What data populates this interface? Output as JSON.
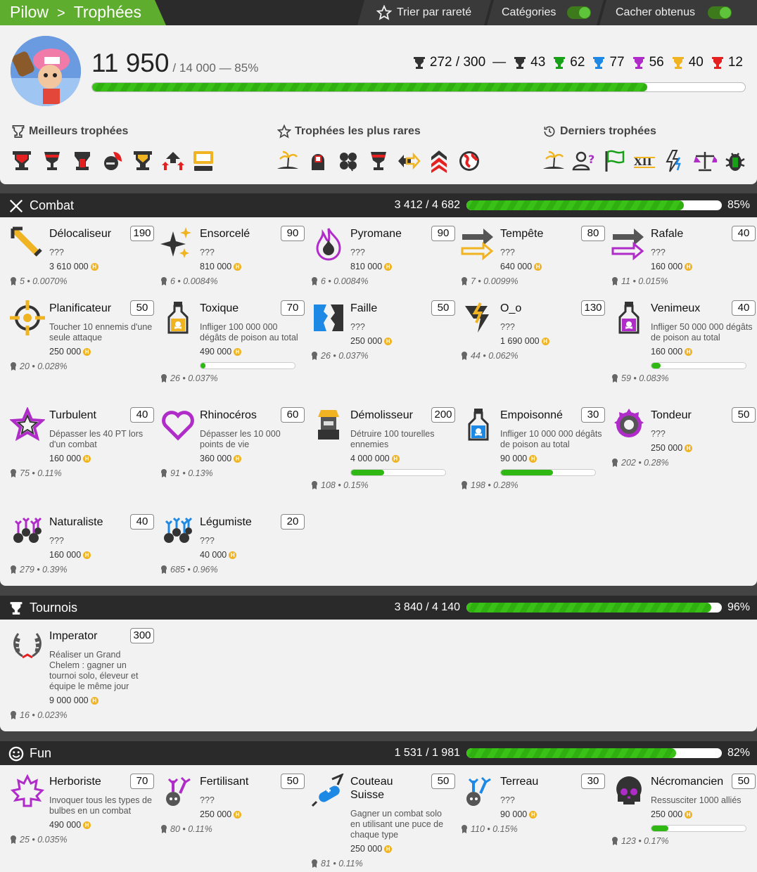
{
  "breadcrumb": {
    "user": "Pilow",
    "page": "Trophées"
  },
  "toolbar": {
    "sort": "Trier par rareté",
    "categories": "Catégories",
    "hide": "Cacher obtenus",
    "categories_on": true,
    "hide_on": true
  },
  "profile": {
    "score": "11 950",
    "max": "/ 14 000 — 85%",
    "progress": 0.85,
    "counts": {
      "total": "272 / 300",
      "dash": "—",
      "grey": "43",
      "green": "62",
      "blue": "77",
      "purple": "56",
      "gold": "40",
      "red": "12"
    },
    "best_label": "Meilleurs trophées",
    "rare_label": "Trophées les plus rares",
    "last_label": "Derniers trophées"
  },
  "colors": {
    "accent": "#5fad2f",
    "grey": "#333333",
    "green": "#18a018",
    "blue": "#1e88e5",
    "purple": "#b02cc9",
    "gold": "#f0b423",
    "red": "#e52020"
  },
  "categories": [
    {
      "name": "Combat",
      "score": "3 412 / 4 682",
      "pct": "85%",
      "progress": 0.85,
      "trophies": [
        {
          "name": "Délocaliseur",
          "points": "190",
          "desc": "???",
          "reward": "3 610 000",
          "rarity": "5 • 0.0070%",
          "icon": "sword-diagonal-icon"
        },
        {
          "name": "Ensorcelé",
          "points": "90",
          "desc": "???",
          "reward": "810 000",
          "rarity": "6 • 0.0084%",
          "icon": "sparkles-icon"
        },
        {
          "name": "Pyromane",
          "points": "90",
          "desc": "???",
          "reward": "810 000",
          "rarity": "6 • 0.0084%",
          "icon": "flames-icon"
        },
        {
          "name": "Tempête",
          "points": "80",
          "desc": "???",
          "reward": "640 000",
          "rarity": "7 • 0.0099%",
          "icon": "double-arrow-icon"
        },
        {
          "name": "Rafale",
          "points": "40",
          "desc": "???",
          "reward": "160 000",
          "rarity": "11 • 0.015%",
          "icon": "double-arrow-icon"
        },
        {
          "name": "Planificateur",
          "points": "50",
          "desc": "Toucher 10 ennemis d'une seule attaque",
          "reward": "250 000",
          "rarity": "20 • 0.028%",
          "icon": "crosshair-icon"
        },
        {
          "name": "Toxique",
          "points": "70",
          "desc": "Infliger 100 000 000 dégâts de poison au total",
          "reward": "490 000",
          "progress": 0.05,
          "rarity": "26 • 0.037%",
          "icon": "poison-bottle-icon"
        },
        {
          "name": "Faille",
          "points": "50",
          "desc": "???",
          "reward": "250 000",
          "rarity": "26 • 0.037%",
          "icon": "broken-wall-icon"
        },
        {
          "name": "O_o",
          "points": "130",
          "desc": "???",
          "reward": "1 690 000",
          "rarity": "44 • 0.062%",
          "icon": "lightning-tornado-icon"
        },
        {
          "name": "Venimeux",
          "points": "40",
          "desc": "Infliger 50 000 000 dégâts de poison au total",
          "reward": "160 000",
          "progress": 0.1,
          "rarity": "59 • 0.083%",
          "icon": "poison-bottle-icon"
        },
        {
          "name": "Turbulent",
          "points": "40",
          "desc": "Dépasser les 40 PT lors d'un combat",
          "reward": "160 000",
          "rarity": "75 • 0.11%",
          "icon": "star-outline-icon"
        },
        {
          "name": "Rhinocéros",
          "points": "60",
          "desc": "Dépasser les 10 000 points de vie",
          "reward": "360 000",
          "rarity": "91 • 0.13%",
          "icon": "heart-outline-icon"
        },
        {
          "name": "Démolisseur",
          "points": "200",
          "desc": "Détruire 100 tourelles ennemies",
          "reward": "4 000 000",
          "progress": 0.35,
          "rarity": "108 • 0.15%",
          "icon": "turret-icon"
        },
        {
          "name": "Empoisonné",
          "points": "30",
          "desc": "Infliger 10 000 000 dégâts de poison au total",
          "reward": "90 000",
          "progress": 0.55,
          "rarity": "198 • 0.28%",
          "icon": "poison-bottle-icon"
        },
        {
          "name": "Tondeur",
          "points": "50",
          "desc": "???",
          "reward": "250 000",
          "rarity": "202 • 0.28%",
          "icon": "saw-blade-icon"
        },
        {
          "name": "Naturaliste",
          "points": "40",
          "desc": "???",
          "reward": "160 000",
          "rarity": "279 • 0.39%",
          "icon": "bulbs-icon"
        },
        {
          "name": "Légumiste",
          "points": "20",
          "desc": "???",
          "reward": "40 000",
          "rarity": "685 • 0.96%",
          "icon": "bulbs-icon"
        }
      ]
    },
    {
      "name": "Tournois",
      "score": "3 840 / 4 140",
      "pct": "96%",
      "progress": 0.96,
      "trophies": [
        {
          "name": "Imperator",
          "points": "300",
          "desc": "Réaliser un Grand Chelem : gagner un tournoi solo, éleveur et équipe le même jour",
          "reward": "9 000 000",
          "rarity": "16 • 0.023%",
          "icon": "laurel-icon"
        }
      ]
    },
    {
      "name": "Fun",
      "score": "1 531 / 1 981",
      "pct": "82%",
      "progress": 0.82,
      "trophies": [
        {
          "name": "Herboriste",
          "points": "70",
          "desc": "Invoquer tous les types de bulbes en un combat",
          "reward": "490 000",
          "rarity": "25 • 0.035%",
          "icon": "maple-leaf-icon"
        },
        {
          "name": "Fertilisant",
          "points": "50",
          "desc": "???",
          "reward": "250 000",
          "rarity": "80 • 0.11%",
          "icon": "bulb-icon"
        },
        {
          "name": "Couteau Suisse",
          "points": "50",
          "desc": "Gagner un combat solo en utilisant une puce de chaque type",
          "reward": "250 000",
          "rarity": "81 • 0.11%",
          "icon": "swiss-knife-icon"
        },
        {
          "name": "Terreau",
          "points": "30",
          "desc": "???",
          "reward": "90 000",
          "rarity": "110 • 0.15%",
          "icon": "bulb-icon"
        },
        {
          "name": "Nécromancien",
          "points": "50",
          "desc": "Ressusciter 1000 alliés",
          "reward": "250 000",
          "progress": 0.18,
          "rarity": "123 • 0.17%",
          "icon": "skull-icon"
        }
      ]
    }
  ]
}
